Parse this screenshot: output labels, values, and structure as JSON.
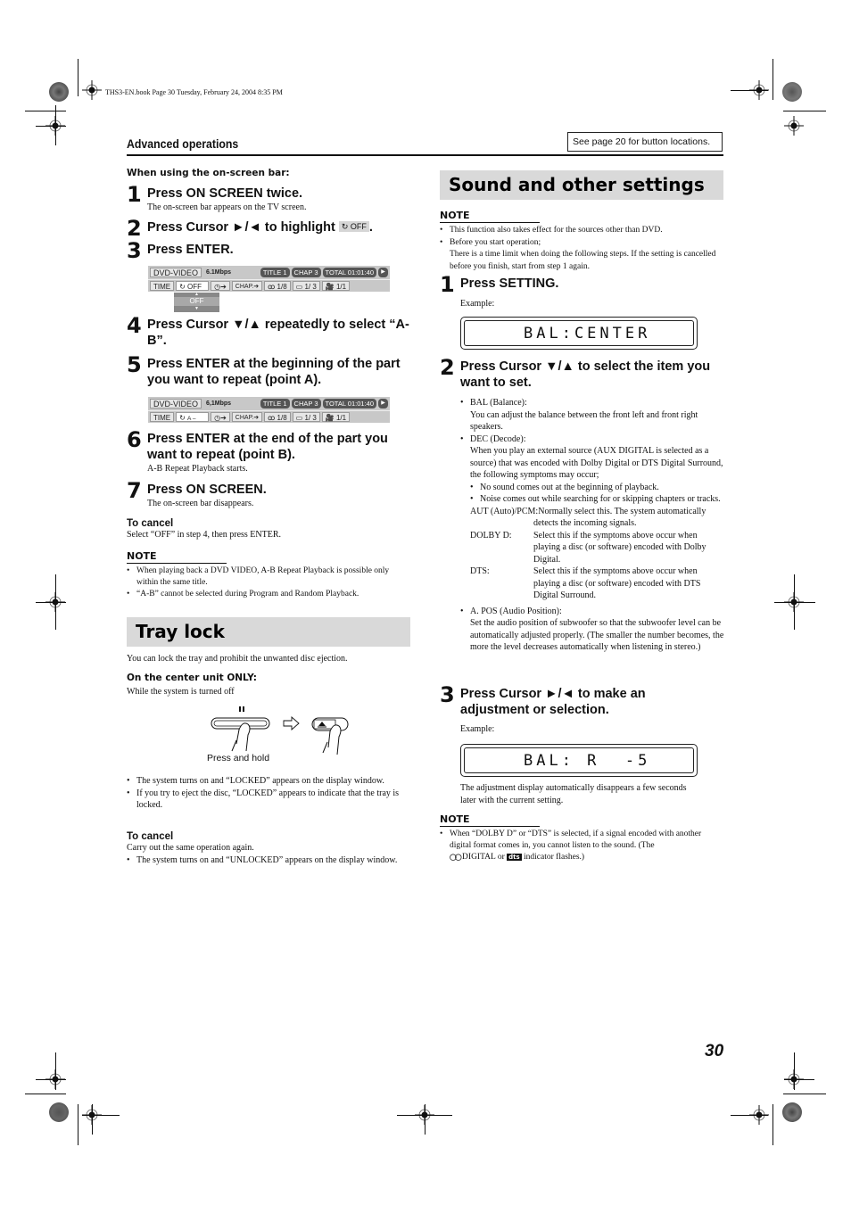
{
  "print_meta": {
    "book_info": "THS3-EN.book  Page 30  Tuesday, February 24, 2004  8:35 PM"
  },
  "header": {
    "section_title": "Advanced operations",
    "reference_note": "See page 20 for button locations."
  },
  "left_column": {
    "onscreen_heading": "When using the on-screen bar:",
    "steps": [
      {
        "num": "1",
        "title": "Press ON SCREEN twice.",
        "desc": "The on-screen bar appears on the TV screen."
      },
      {
        "num": "2",
        "title_prefix": "Press Cursor ►/◄ to highlight",
        "highlight_icon": "repeat-icon",
        "highlight_text": "OFF",
        "title_suffix": "."
      },
      {
        "num": "3",
        "title": "Press ENTER."
      },
      {
        "num": "4",
        "title": "Press Cursor ▼/▲ repeatedly to select “A-B”."
      },
      {
        "num": "5",
        "title": "Press ENTER at the beginning of the part you want to repeat (point A)."
      },
      {
        "num": "6",
        "title": "Press ENTER at the end of the part you want to repeat (point B).",
        "desc": "A-B Repeat Playback starts."
      },
      {
        "num": "7",
        "title": "Press ON SCREEN.",
        "desc": "The on-screen bar disappears."
      }
    ],
    "onscreen_bar_1": {
      "source": "DVD-VIDEO",
      "bitrate": "6.1Mbps",
      "title": "TITLE  1",
      "chapter": "CHAP  3",
      "total": "TOTAL 01:01:40",
      "time_label": "TIME",
      "repeat_value": "OFF",
      "chap_label": "CHAP.",
      "audio": "1/8",
      "subtitle": "1/ 3",
      "angle": "1/1",
      "dropdown_value": "OFF"
    },
    "onscreen_bar_2": {
      "source": "DVD-VIDEO",
      "bitrate": "6,1Mbps",
      "title": "TITLE  1",
      "chapter": "CHAP  3",
      "total": "TOTAL 01:01:40",
      "time_label": "TIME",
      "repeat_value": "A –",
      "chap_label": "CHAP.",
      "audio": "1/8",
      "subtitle": "1/ 3",
      "angle": "1/1"
    },
    "to_cancel": {
      "heading": "To cancel",
      "text": "Select “OFF” in step 4, then press ENTER."
    },
    "note": {
      "heading": "NOTE",
      "items": [
        "When playing back a DVD VIDEO, A-B Repeat Playback is possible only within the same title.",
        "“A-B” cannot be selected during Program and Random Playback."
      ]
    },
    "tray_lock": {
      "title": "Tray lock",
      "intro": "You can lock the tray and prohibit the unwanted disc ejection.",
      "subheading": "On the center unit ONLY:",
      "condition": "While the system is turned off",
      "illustration_caption": "Press and hold",
      "bullets": [
        "The system turns on and “LOCKED” appears on the display window.",
        "If you try to eject the disc, “LOCKED” appears to indicate that the tray is locked."
      ],
      "cancel_heading": "To cancel",
      "cancel_text": "Carry out the same operation again.",
      "cancel_bullets": [
        "The system turns on and “UNLOCKED” appears on the display window."
      ]
    }
  },
  "right_column": {
    "title": "Sound and other settings",
    "note": {
      "heading": "NOTE",
      "items": [
        "This function also takes effect for the sources other than DVD.",
        "Before you start operation;"
      ],
      "continuation": "There is a time limit when doing the following steps. If the setting is cancelled before you finish, start from step 1 again."
    },
    "steps": [
      {
        "num": "1",
        "title": "Press SETTING.",
        "example_label": "Example:",
        "display": "BAL:CENTER"
      },
      {
        "num": "2",
        "title": "Press Cursor ▼/▲ to select the item you want to set."
      },
      {
        "num": "3",
        "title": "Press Cursor ►/◄ to make an adjustment or selection.",
        "example_label": "Example:",
        "display": "BAL: R  -5",
        "after": "The adjustment display automatically disappears a few seconds later with the current setting."
      }
    ],
    "items": {
      "bal_title": "BAL (Balance):",
      "bal_text": "You can adjust the balance between the front left and front right speakers.",
      "dec_title": "DEC (Decode):",
      "dec_text": "When you play an external source (AUX DIGITAL is selected as a source) that was encoded with Dolby Digital or DTS Digital Surround, the following symptoms may occur;",
      "dec_symptoms": [
        "No sound comes out at the beginning of playback.",
        "Noise comes out while searching for or skipping chapters or tracks."
      ],
      "dec_options": [
        {
          "term": "AUT (Auto)/PCM:",
          "text": "Normally select this. The system automatically detects the incoming signals."
        },
        {
          "term": "DOLBY D:",
          "text": "Select this if the symptoms above occur when playing a disc (or software) encoded with Dolby Digital."
        },
        {
          "term": "DTS:",
          "text": "Select this if the symptoms above occur when playing a disc (or software) encoded with DTS Digital Surround."
        }
      ],
      "apos_title": "A. POS (Audio Position):",
      "apos_text": "Set the audio position of subwoofer so that the subwoofer level can be automatically adjusted properly. (The smaller the number becomes, the more the level decreases automatically when listening in stereo.)"
    },
    "note2": {
      "heading": "NOTE",
      "text_a": "When “DOLBY D” or “DTS” is selected, if a signal encoded with another digital format comes in, you cannot listen to the sound. (The",
      "dolby_icon": "◯◯",
      "text_b": "DIGITAL or",
      "dts_icon": "dts",
      "text_c": "indicator flashes.)"
    }
  },
  "footer": {
    "page_number": "30"
  }
}
